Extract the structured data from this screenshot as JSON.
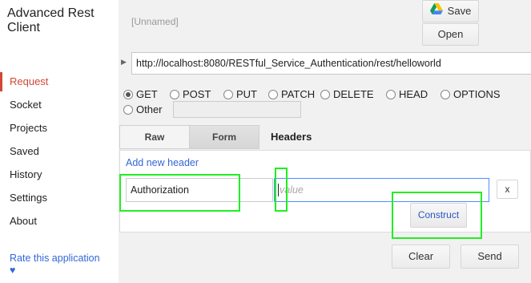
{
  "app": {
    "title": "Advanced Rest Client"
  },
  "sidebar": {
    "items": [
      {
        "label": "Request",
        "active": true
      },
      {
        "label": "Socket"
      },
      {
        "label": "Projects"
      },
      {
        "label": "Saved"
      },
      {
        "label": "History"
      },
      {
        "label": "Settings"
      },
      {
        "label": "About"
      }
    ],
    "rate_label": "Rate this application ♥"
  },
  "request": {
    "name_placeholder": "[Unnamed]",
    "url": "http://localhost:8080/RESTful_Service_Authentication/rest/helloworld",
    "save_label": "Save",
    "open_label": "Open",
    "methods": [
      "GET",
      "POST",
      "PUT",
      "PATCH",
      "DELETE",
      "HEAD",
      "OPTIONS",
      "Other"
    ],
    "selected_method": "GET"
  },
  "tabs": {
    "raw": "Raw",
    "form": "Form",
    "headers": "Headers"
  },
  "headers_form": {
    "add_link": "Add new header",
    "key": "Authorization",
    "value_placeholder": "value",
    "remove_label": "x",
    "construct_label": "Construct"
  },
  "actions": {
    "clear_label": "Clear",
    "send_label": "Send"
  },
  "colors": {
    "accent": "#d14836",
    "link": "#3367d6",
    "focus": "#4d90fe",
    "highlight": "#22ee22"
  },
  "icons": {
    "save": "google-drive-icon",
    "url_expand": "triangle-right-icon"
  }
}
